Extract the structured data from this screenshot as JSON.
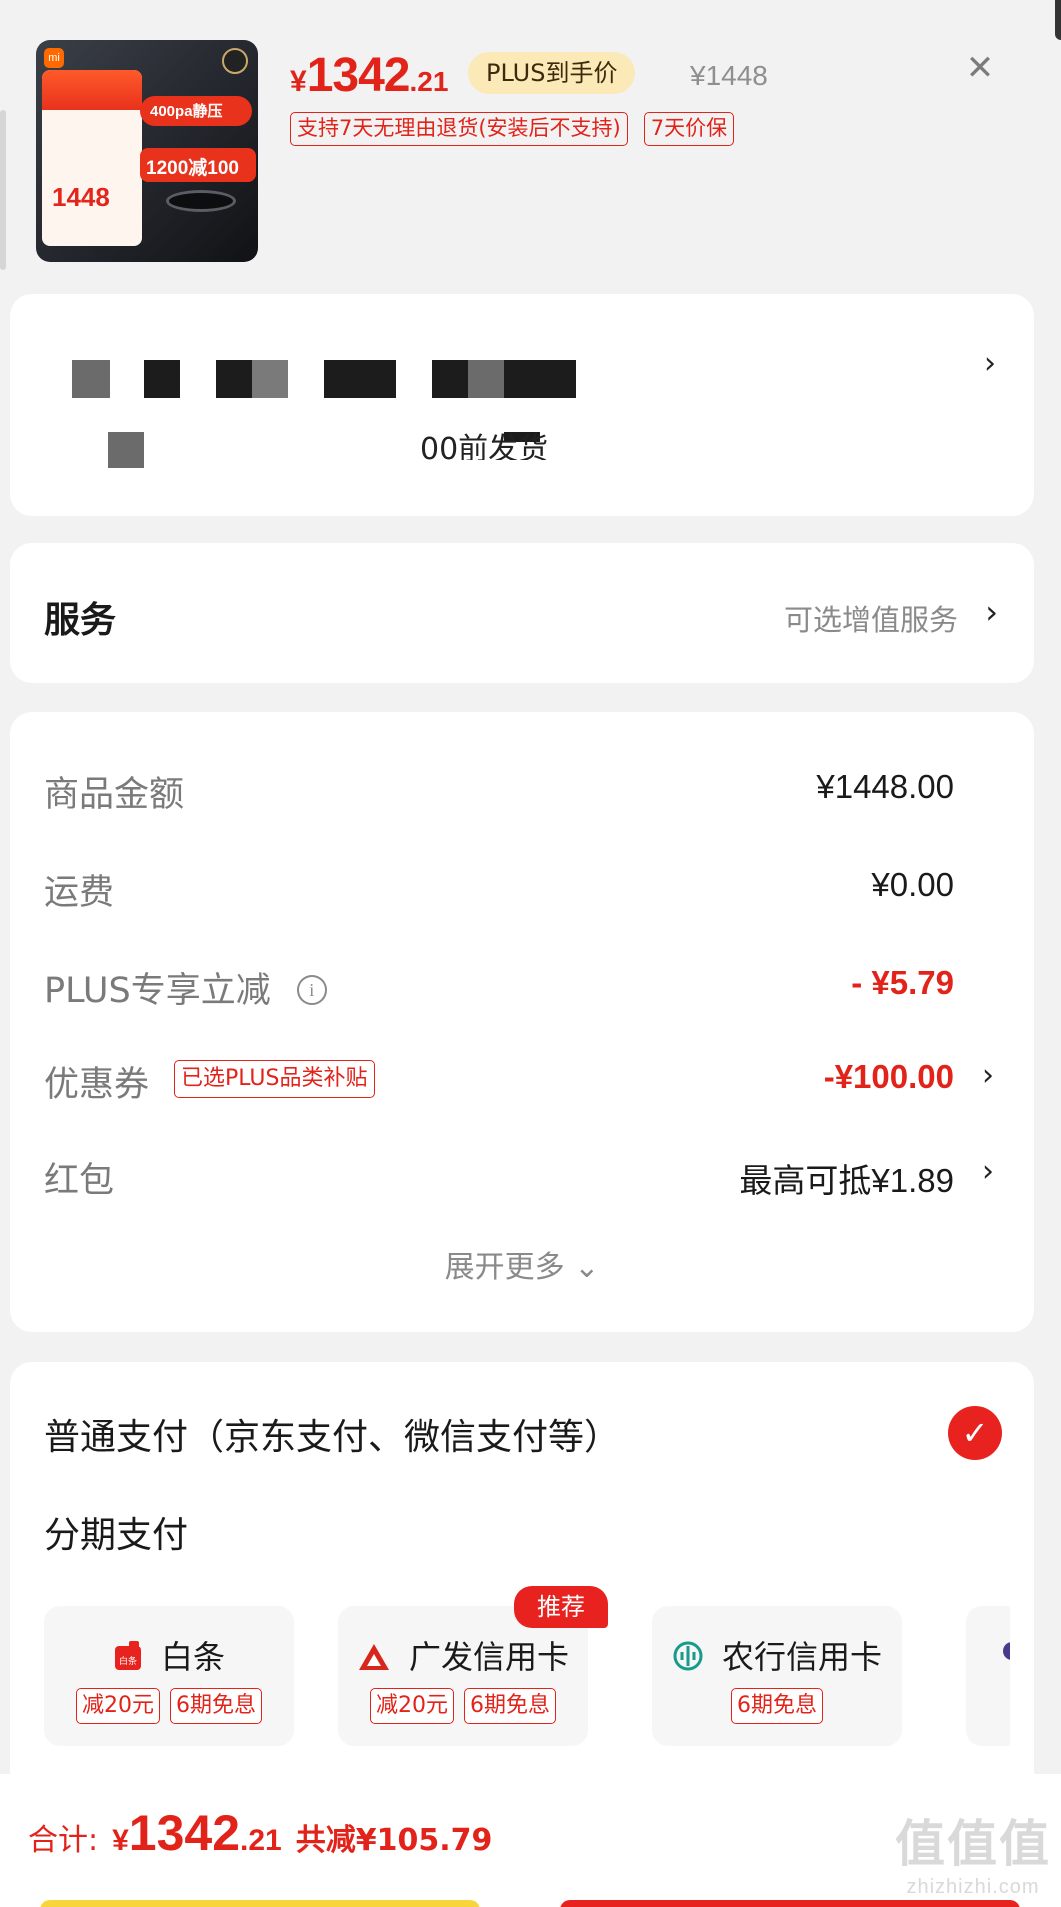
{
  "product": {
    "image_label": "商品图片",
    "image_price": "1448",
    "image_banner_top": "400pa静压",
    "image_banner_main": "1200减100",
    "price_symbol": "¥",
    "price_integer": "1342",
    "price_decimal": ".21",
    "plus_badge": "PLUS到手价",
    "original_price": "¥1448",
    "tags": [
      "支持7天无理由退货(安装后不支持)",
      "7天价保"
    ],
    "close_label": "✕"
  },
  "address": {
    "line2_visible": "00前发货",
    "chevron": "›"
  },
  "service": {
    "title": "服务",
    "hint": "可选增值服务",
    "chevron": "›"
  },
  "pricing": {
    "rows": [
      {
        "label": "商品金额",
        "value": "¥1448.00"
      },
      {
        "label": "运费",
        "value": "¥0.00"
      },
      {
        "label": "PLUS专享立减",
        "value": "- ¥5.79",
        "info_icon": "i"
      },
      {
        "label": "优惠券",
        "tag": "已选PLUS品类补贴",
        "value": "-¥100.00",
        "chevron": "›"
      },
      {
        "label": "红包",
        "value": "最高可抵¥1.89",
        "chevron": "›"
      }
    ],
    "expand_label": "展开更多 ⌄"
  },
  "payment": {
    "normal_label": "普通支付（京东支付、微信支付等）",
    "check": "✓",
    "installment_label": "分期支付",
    "recommend_badge": "推荐",
    "options": [
      {
        "name": "白条",
        "icon": "baitiao-icon",
        "tags": [
          "减20元",
          "6期免息"
        ]
      },
      {
        "name": "广发信用卡",
        "icon": "cgb-icon",
        "tags": [
          "减20元",
          "6期免息"
        ]
      },
      {
        "name": "农行信用卡",
        "icon": "abc-icon",
        "tags": [
          "6期免息"
        ]
      }
    ]
  },
  "footer": {
    "total_label": "合计:",
    "total_symbol": "¥",
    "total_integer": "1342",
    "total_decimal": ".21",
    "savings": "共减¥105.79",
    "watermark_main": "值值值",
    "watermark_sub": "zhizhizhi.com"
  },
  "colors": {
    "accent_red": "#e2231a",
    "plus_gold": "#fbe9b8",
    "background": "#f2f2f2"
  }
}
